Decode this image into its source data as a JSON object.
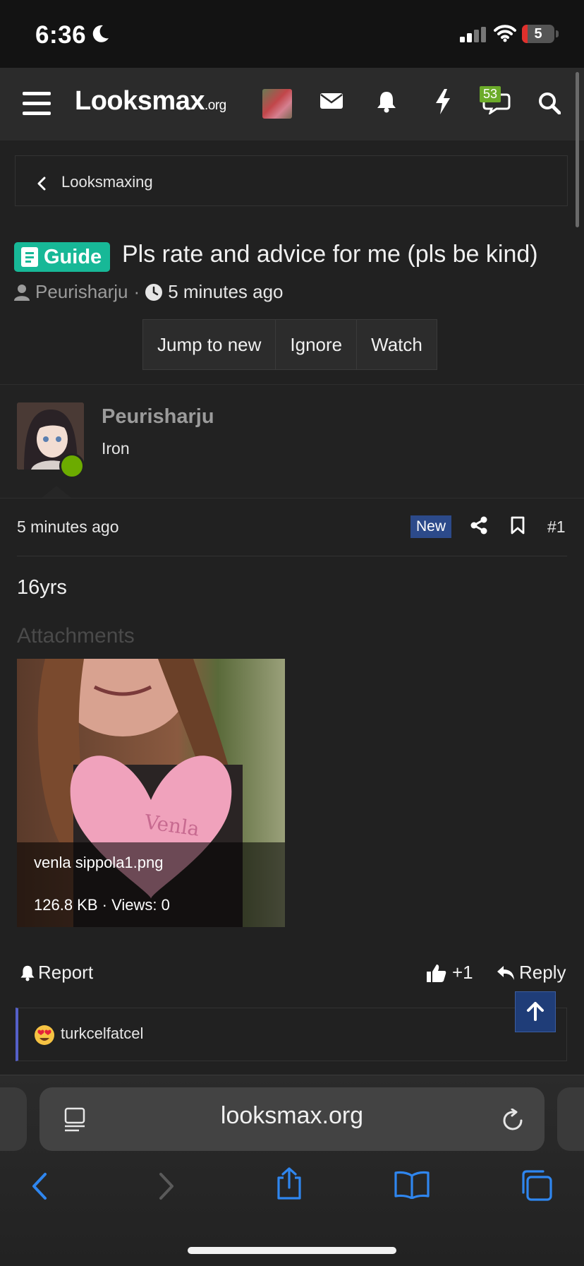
{
  "status_bar": {
    "time": "6:36",
    "battery": "5"
  },
  "nav": {
    "logo_main": "Looksmax",
    "logo_suffix": ".org",
    "chat_badge": "53"
  },
  "breadcrumb": {
    "label": "Looksmaxing"
  },
  "thread": {
    "prefix": "Guide",
    "title": "Pls rate and advice for me (pls be kind)",
    "author": "Peurisharju",
    "separator": "·",
    "time": "5 minutes ago",
    "actions": [
      "Jump to new",
      "Ignore",
      "Watch"
    ]
  },
  "post": {
    "username": "Peurisharju",
    "rank": "Iron",
    "time": "5 minutes ago",
    "new_label": "New",
    "number": "#1",
    "body": "16yrs",
    "attachments_heading": "Attachments",
    "attachment": {
      "filename": "venla sippola1.png",
      "meta": "126.8 KB · Views: 0"
    },
    "report_label": "Report",
    "like_count": "+1",
    "reply_label": "Reply",
    "reaction_user": "turkcelfatcel"
  },
  "browser": {
    "url": "looksmax.org"
  },
  "colors": {
    "accent_guide": "#17b897",
    "online": "#6cab00",
    "new_badge": "#2c4a8a",
    "safari_blue": "#2f86ef"
  }
}
